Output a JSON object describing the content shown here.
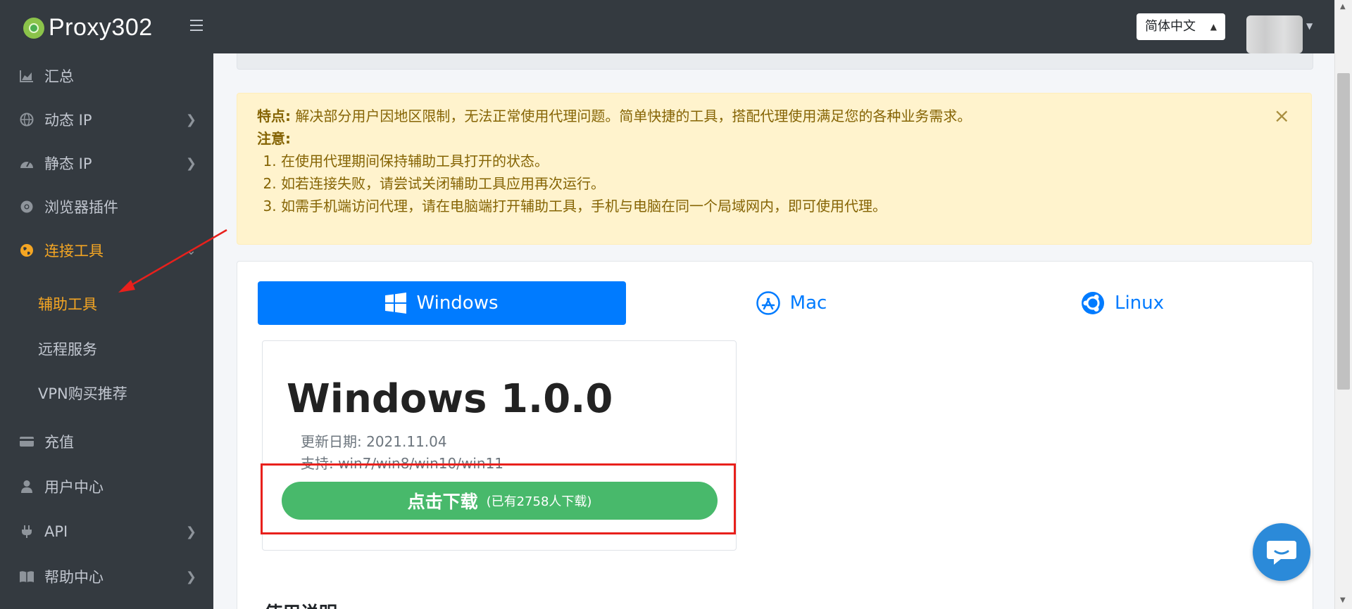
{
  "header": {
    "logo_text": "Proxy302",
    "language": "简体中文"
  },
  "sidebar": {
    "items": [
      {
        "label": "汇总",
        "icon": "chart-area-icon"
      },
      {
        "label": "动态 IP",
        "icon": "globe-icon"
      },
      {
        "label": "静态 IP",
        "icon": "gauge-icon"
      },
      {
        "label": "浏览器插件",
        "icon": "chrome-icon"
      },
      {
        "label": "连接工具",
        "icon": "globe-filled-icon"
      },
      {
        "label": "充值",
        "icon": "credit-card-icon"
      },
      {
        "label": "用户中心",
        "icon": "user-icon"
      },
      {
        "label": "API",
        "icon": "plug-icon"
      },
      {
        "label": "帮助中心",
        "icon": "book-icon"
      }
    ],
    "sub_items": [
      "辅助工具",
      "远程服务",
      "VPN购买推荐"
    ],
    "active_color": "#f5a623"
  },
  "alert": {
    "feature_label": "特点:",
    "feature_text": "解决部分用户因地区限制，无法正常使用代理问题。简单快捷的工具，搭配代理使用满足您的各种业务需求。",
    "notice_label": "注意:",
    "notes": [
      "在使用代理期间保持辅助工具打开的状态。",
      "如若连接失败，请尝试关闭辅助工具应用再次运行。",
      "如需手机端访问代理，请在电脑端打开辅助工具，手机与电脑在同一个局域网内，即可使用代理。"
    ],
    "close_symbol": "×"
  },
  "tabs": [
    {
      "label": "Windows",
      "icon": "windows-icon",
      "active": true
    },
    {
      "label": "Mac",
      "icon": "app-store-icon",
      "active": false
    },
    {
      "label": "Linux",
      "icon": "ubuntu-icon",
      "active": false
    }
  ],
  "download": {
    "version_title": "Windows 1.0.0",
    "update_date": "更新日期: 2021.11.04",
    "support": "支持: win7/win8/win10/win11",
    "button_label": "点击下载",
    "download_count": "(已有2758人下载)",
    "button_color": "#48b96b"
  },
  "usage_title": "使用说明",
  "colors": {
    "primary": "#007bff",
    "annotation_red": "#e8201c",
    "alert_bg": "#fff3cd",
    "alert_text": "#856404"
  }
}
